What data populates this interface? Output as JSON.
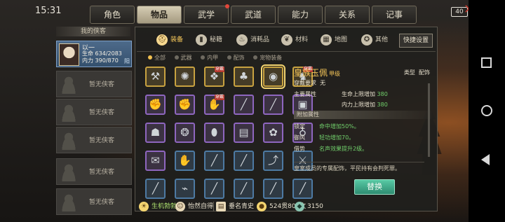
{
  "status_bar": {
    "time": "15:31",
    "battery_level": "40",
    "battery_warning_icon": "close-x-icon"
  },
  "tabs": [
    {
      "label": "角色",
      "active": false
    },
    {
      "label": "物品",
      "active": true
    },
    {
      "label": "武学",
      "active": false,
      "notify": true
    },
    {
      "label": "武道",
      "active": false
    },
    {
      "label": "能力",
      "active": false
    },
    {
      "label": "关系",
      "active": false
    },
    {
      "label": "记事",
      "active": false
    }
  ],
  "companions": {
    "title": "我的侠客",
    "hero": {
      "name": "以一",
      "hp_label": "生命",
      "hp_value": "634/2083",
      "mp_label": "内力",
      "mp_value": "390/870",
      "tag": "阳"
    },
    "empty_label": "暂无侠客"
  },
  "categories": [
    {
      "label": "装备",
      "icon": "helmet-icon",
      "active": true
    },
    {
      "label": "秘籍",
      "icon": "book-icon"
    },
    {
      "label": "消耗品",
      "icon": "potion-icon"
    },
    {
      "label": "材料",
      "icon": "herb-icon"
    },
    {
      "label": "地图",
      "icon": "map-icon"
    },
    {
      "label": "其他",
      "icon": "medal-icon"
    }
  ],
  "quick_settings": "快捷设置",
  "filters": [
    {
      "label": "全部",
      "active": true
    },
    {
      "label": "武器"
    },
    {
      "label": "内甲"
    },
    {
      "label": "配饰"
    },
    {
      "label": "宠物装备"
    }
  ],
  "equipped_badge": "穿戴",
  "items": [
    {
      "icon": "axe-icon",
      "glyph": "⚒",
      "rarity": "gold",
      "equipped": false
    },
    {
      "icon": "fan-icon",
      "glyph": "✺",
      "rarity": "gold",
      "equipped": false
    },
    {
      "icon": "dragon-armor-icon",
      "glyph": "❖",
      "rarity": "gold",
      "equipped": true
    },
    {
      "icon": "vest-icon",
      "glyph": "♣",
      "rarity": "gold",
      "equipped": false
    },
    {
      "icon": "jade-pendant-icon",
      "glyph": "◉",
      "rarity": "gold",
      "equipped": false,
      "selected": true
    },
    {
      "icon": "beast-icon",
      "glyph": "♞",
      "rarity": "gold",
      "equipped": true
    },
    {
      "icon": "gauntlet-icon",
      "glyph": "✊",
      "rarity": "purple",
      "equipped": false
    },
    {
      "icon": "gauntlet-icon",
      "glyph": "✊",
      "rarity": "purple",
      "equipped": false
    },
    {
      "icon": "claw-icon",
      "glyph": "✋",
      "rarity": "purple",
      "equipped": true
    },
    {
      "icon": "spear-icon",
      "glyph": "╱",
      "rarity": "purple",
      "equipped": false
    },
    {
      "icon": "staff-icon",
      "glyph": "╱",
      "rarity": "purple",
      "equipped": false
    },
    {
      "icon": "armor-icon",
      "glyph": "▣",
      "rarity": "purple",
      "equipped": false
    },
    {
      "icon": "cloth-icon",
      "glyph": "☗",
      "rarity": "purple",
      "equipped": false
    },
    {
      "icon": "bracelet-icon",
      "glyph": "❂",
      "rarity": "purple",
      "equipped": false
    },
    {
      "icon": "shield-icon",
      "glyph": "⬮",
      "rarity": "purple",
      "equipped": false
    },
    {
      "icon": "chest-icon",
      "glyph": "▤",
      "rarity": "purple",
      "equipped": false
    },
    {
      "icon": "scroll-icon",
      "glyph": "✿",
      "rarity": "purple",
      "equipped": false
    },
    {
      "icon": "gourd-icon",
      "glyph": "♁",
      "rarity": "purple",
      "equipped": false
    },
    {
      "icon": "token-icon",
      "glyph": "✉",
      "rarity": "purple",
      "equipped": false
    },
    {
      "icon": "glove-icon",
      "glyph": "✋",
      "rarity": "blue",
      "equipped": false
    },
    {
      "icon": "dagger-icon",
      "glyph": "╱",
      "rarity": "blue",
      "equipped": false
    },
    {
      "icon": "blade-icon",
      "glyph": "╱",
      "rarity": "blue",
      "equipped": false
    },
    {
      "icon": "sickle-icon",
      "glyph": "⤴",
      "rarity": "blue",
      "equipped": false
    },
    {
      "icon": "halberd-icon",
      "glyph": "⚔",
      "rarity": "blue",
      "equipped": false
    },
    {
      "icon": "sword-icon",
      "glyph": "╱",
      "rarity": "blue",
      "equipped": false
    },
    {
      "icon": "whip-icon",
      "glyph": "⌁",
      "rarity": "blue",
      "equipped": false
    },
    {
      "icon": "spear-icon",
      "glyph": "╱",
      "rarity": "blue",
      "equipped": false
    },
    {
      "icon": "sword-icon",
      "glyph": "╱",
      "rarity": "blue",
      "equipped": false
    },
    {
      "icon": "dagger-icon",
      "glyph": "╱",
      "rarity": "blue",
      "equipped": false
    },
    {
      "icon": "blade-icon",
      "glyph": "╱",
      "rarity": "blue",
      "equipped": false
    }
  ],
  "detail": {
    "name": "皇族玉佩",
    "grade": "甲级",
    "type_label": "类型",
    "type_value": "配饰",
    "req_label": "穿戴要求",
    "req_value": "无",
    "main_label": "主要属性",
    "attr1_name": "生命上限增加",
    "attr1_value": "380",
    "attr2_name": "内力上限增加",
    "attr2_value": "380",
    "extra_title": "附加属性",
    "extras": [
      {
        "name": "锁定",
        "value": "命中增加50%。"
      },
      {
        "name": "御风",
        "value": "轻功增加70。"
      },
      {
        "name": "借势",
        "value": "名声效果提升2级。"
      }
    ],
    "description": "皇室成员的专属配饰，平民持有会判死罪。",
    "replace_label": "替换"
  },
  "bottom": {
    "mood": "生机勃勃",
    "state": "怡然自得",
    "fame": "垂名青史",
    "money": "524贯806文",
    "coins": "3150"
  },
  "colors": {
    "accent_gold": "#f3c458",
    "green_attr": "#71d06b",
    "button_teal": "#3fae8b"
  }
}
